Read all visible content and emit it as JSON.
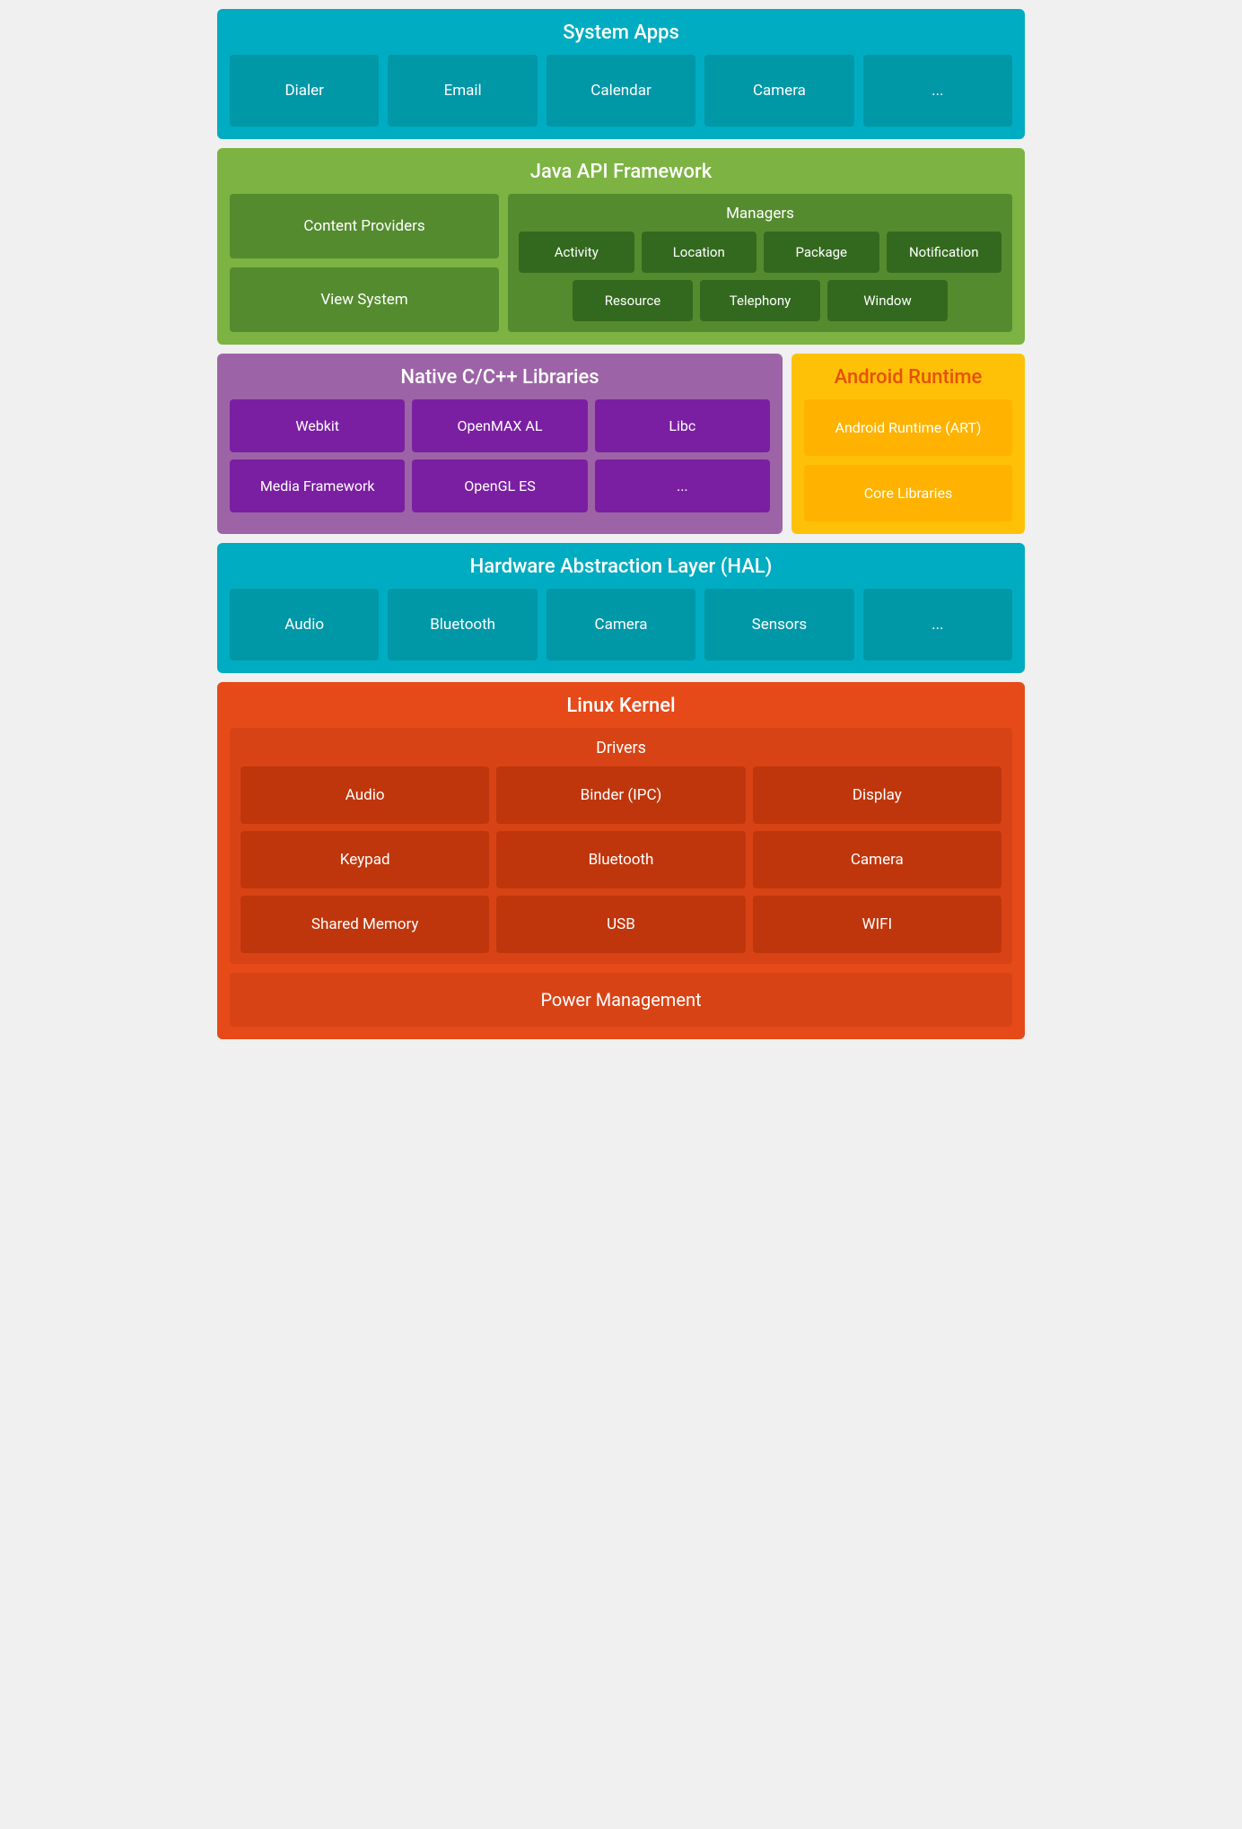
{
  "systemApps": {
    "title": "System Apps",
    "items": [
      "Dialer",
      "Email",
      "Calendar",
      "Camera",
      "..."
    ]
  },
  "javaApi": {
    "title": "Java API Framework",
    "contentProviders": "Content Providers",
    "viewSystem": "View System",
    "managers": {
      "title": "Managers",
      "row1": [
        "Activity",
        "Location",
        "Package",
        "Notification"
      ],
      "row2": [
        "Resource",
        "Telephony",
        "Window"
      ]
    }
  },
  "nativeCpp": {
    "title": "Native C/C++ Libraries",
    "items": [
      "Webkit",
      "OpenMAX AL",
      "Libc",
      "Media Framework",
      "OpenGL ES",
      "..."
    ]
  },
  "androidRuntime": {
    "title": "Android Runtime",
    "items": [
      "Android Runtime (ART)",
      "Core Libraries"
    ]
  },
  "hal": {
    "title": "Hardware Abstraction Layer (HAL)",
    "items": [
      "Audio",
      "Bluetooth",
      "Camera",
      "Sensors",
      "..."
    ]
  },
  "linuxKernel": {
    "title": "Linux Kernel",
    "drivers": {
      "title": "Drivers",
      "items": [
        "Audio",
        "Binder (IPC)",
        "Display",
        "Keypad",
        "Bluetooth",
        "Camera",
        "Shared Memory",
        "USB",
        "WIFI"
      ]
    },
    "powerManagement": "Power Management"
  }
}
